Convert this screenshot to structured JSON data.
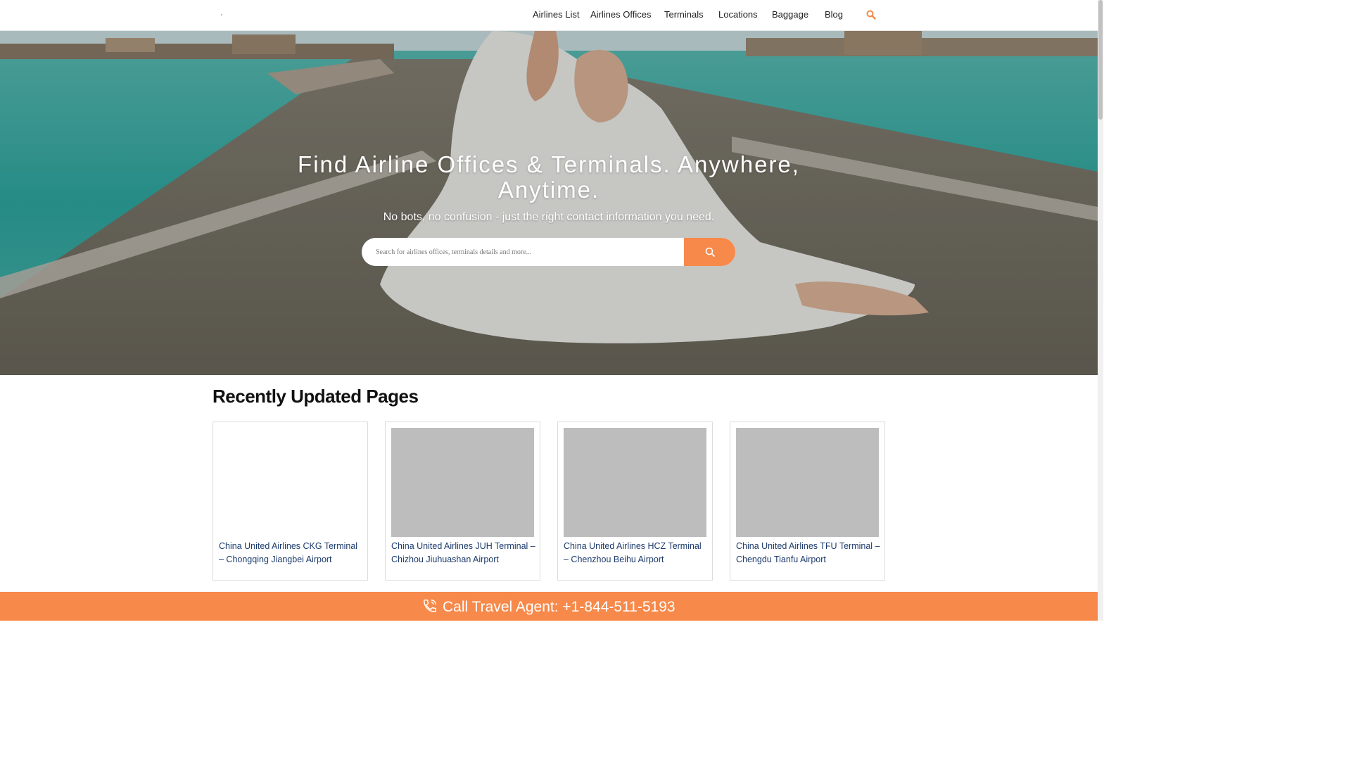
{
  "nav": {
    "items": [
      {
        "label": "Airlines List"
      },
      {
        "label": "Airlines Offices"
      },
      {
        "label": "Terminals"
      },
      {
        "label": "Locations"
      },
      {
        "label": "Baggage"
      },
      {
        "label": "Blog"
      }
    ],
    "search_icon": "search-icon"
  },
  "hero": {
    "title": "Find Airline Offices & Terminals. Anywhere, Anytime.",
    "subtitle": "No bots, no confusion - just the right contact information you need.",
    "search_placeholder": "Search for airlines offices, terminals details and more...",
    "search_value": ""
  },
  "section": {
    "title": "Recently Updated Pages",
    "cards": [
      {
        "title": "China United Airlines CKG Terminal – Chongqing Jiangbei Airport"
      },
      {
        "title": "China United Airlines JUH Terminal – Chizhou Jiuhuashan Airport"
      },
      {
        "title": "China United Airlines HCZ Terminal – Chenzhou Beihu Airport"
      },
      {
        "title": "China United Airlines TFU Terminal – Chengdu Tianfu Airport"
      }
    ]
  },
  "call_bar": {
    "text": "Call Travel Agent: +1-844-511-5193",
    "icon": "phone-icon"
  },
  "colors": {
    "accent": "#f7894a",
    "link": "#1b3a6b",
    "placeholder_image": "#bdbdbd"
  }
}
